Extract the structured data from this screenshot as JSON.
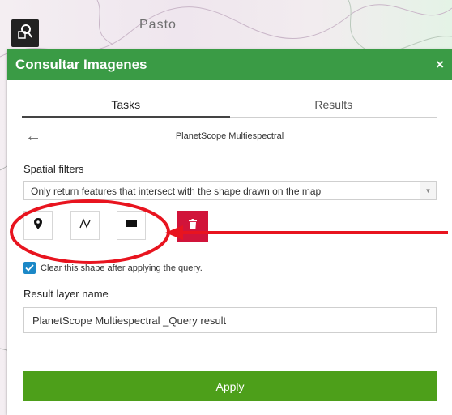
{
  "map": {
    "place_label": "Pasto"
  },
  "tool": {
    "icon": "search-map-icon"
  },
  "panel": {
    "title": "Consultar Imagenes",
    "close_label": "×",
    "tabs": [
      {
        "label": "Tasks",
        "active": true
      },
      {
        "label": "Results",
        "active": false
      }
    ],
    "subheader": {
      "back_icon": "←",
      "title": "PlanetScope Multiespectral"
    },
    "spatial_filters": {
      "label": "Spatial filters",
      "selected_option": "Only return features that intersect with the shape drawn on the map",
      "draw_tools": [
        "point-icon",
        "polyline-icon",
        "rectangle-icon"
      ],
      "delete_icon": "trash-icon",
      "delete_color": "#d1143a"
    },
    "clear_shape": {
      "checked": true,
      "label": "Clear this shape after applying the query."
    },
    "result_layer": {
      "label": "Result layer name",
      "value": "PlanetScope Multiespectral _Query result"
    },
    "apply_label": "Apply",
    "colors": {
      "header": "#3a9b45",
      "apply": "#4d9f1a",
      "checkbox": "#1b88c7",
      "annotation": "#e8141f"
    }
  }
}
